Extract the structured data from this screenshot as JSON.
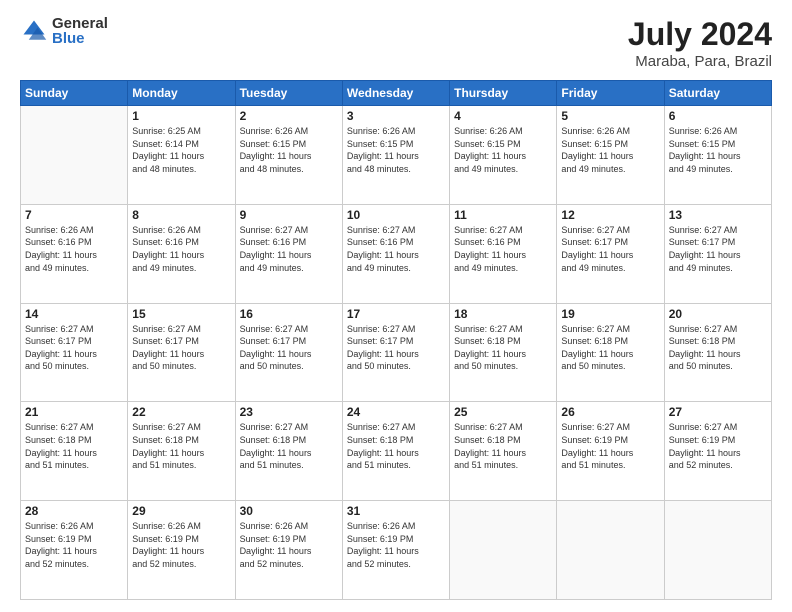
{
  "header": {
    "logo_general": "General",
    "logo_blue": "Blue",
    "month_year": "July 2024",
    "location": "Maraba, Para, Brazil"
  },
  "days_of_week": [
    "Sunday",
    "Monday",
    "Tuesday",
    "Wednesday",
    "Thursday",
    "Friday",
    "Saturday"
  ],
  "weeks": [
    [
      {
        "day": "",
        "info": ""
      },
      {
        "day": "1",
        "info": "Sunrise: 6:25 AM\nSunset: 6:14 PM\nDaylight: 11 hours\nand 48 minutes."
      },
      {
        "day": "2",
        "info": "Sunrise: 6:26 AM\nSunset: 6:15 PM\nDaylight: 11 hours\nand 48 minutes."
      },
      {
        "day": "3",
        "info": "Sunrise: 6:26 AM\nSunset: 6:15 PM\nDaylight: 11 hours\nand 48 minutes."
      },
      {
        "day": "4",
        "info": "Sunrise: 6:26 AM\nSunset: 6:15 PM\nDaylight: 11 hours\nand 49 minutes."
      },
      {
        "day": "5",
        "info": "Sunrise: 6:26 AM\nSunset: 6:15 PM\nDaylight: 11 hours\nand 49 minutes."
      },
      {
        "day": "6",
        "info": "Sunrise: 6:26 AM\nSunset: 6:15 PM\nDaylight: 11 hours\nand 49 minutes."
      }
    ],
    [
      {
        "day": "7",
        "info": "Sunrise: 6:26 AM\nSunset: 6:16 PM\nDaylight: 11 hours\nand 49 minutes."
      },
      {
        "day": "8",
        "info": "Sunrise: 6:26 AM\nSunset: 6:16 PM\nDaylight: 11 hours\nand 49 minutes."
      },
      {
        "day": "9",
        "info": "Sunrise: 6:27 AM\nSunset: 6:16 PM\nDaylight: 11 hours\nand 49 minutes."
      },
      {
        "day": "10",
        "info": "Sunrise: 6:27 AM\nSunset: 6:16 PM\nDaylight: 11 hours\nand 49 minutes."
      },
      {
        "day": "11",
        "info": "Sunrise: 6:27 AM\nSunset: 6:16 PM\nDaylight: 11 hours\nand 49 minutes."
      },
      {
        "day": "12",
        "info": "Sunrise: 6:27 AM\nSunset: 6:17 PM\nDaylight: 11 hours\nand 49 minutes."
      },
      {
        "day": "13",
        "info": "Sunrise: 6:27 AM\nSunset: 6:17 PM\nDaylight: 11 hours\nand 49 minutes."
      }
    ],
    [
      {
        "day": "14",
        "info": "Sunrise: 6:27 AM\nSunset: 6:17 PM\nDaylight: 11 hours\nand 50 minutes."
      },
      {
        "day": "15",
        "info": "Sunrise: 6:27 AM\nSunset: 6:17 PM\nDaylight: 11 hours\nand 50 minutes."
      },
      {
        "day": "16",
        "info": "Sunrise: 6:27 AM\nSunset: 6:17 PM\nDaylight: 11 hours\nand 50 minutes."
      },
      {
        "day": "17",
        "info": "Sunrise: 6:27 AM\nSunset: 6:17 PM\nDaylight: 11 hours\nand 50 minutes."
      },
      {
        "day": "18",
        "info": "Sunrise: 6:27 AM\nSunset: 6:18 PM\nDaylight: 11 hours\nand 50 minutes."
      },
      {
        "day": "19",
        "info": "Sunrise: 6:27 AM\nSunset: 6:18 PM\nDaylight: 11 hours\nand 50 minutes."
      },
      {
        "day": "20",
        "info": "Sunrise: 6:27 AM\nSunset: 6:18 PM\nDaylight: 11 hours\nand 50 minutes."
      }
    ],
    [
      {
        "day": "21",
        "info": "Sunrise: 6:27 AM\nSunset: 6:18 PM\nDaylight: 11 hours\nand 51 minutes."
      },
      {
        "day": "22",
        "info": "Sunrise: 6:27 AM\nSunset: 6:18 PM\nDaylight: 11 hours\nand 51 minutes."
      },
      {
        "day": "23",
        "info": "Sunrise: 6:27 AM\nSunset: 6:18 PM\nDaylight: 11 hours\nand 51 minutes."
      },
      {
        "day": "24",
        "info": "Sunrise: 6:27 AM\nSunset: 6:18 PM\nDaylight: 11 hours\nand 51 minutes."
      },
      {
        "day": "25",
        "info": "Sunrise: 6:27 AM\nSunset: 6:18 PM\nDaylight: 11 hours\nand 51 minutes."
      },
      {
        "day": "26",
        "info": "Sunrise: 6:27 AM\nSunset: 6:19 PM\nDaylight: 11 hours\nand 51 minutes."
      },
      {
        "day": "27",
        "info": "Sunrise: 6:27 AM\nSunset: 6:19 PM\nDaylight: 11 hours\nand 52 minutes."
      }
    ],
    [
      {
        "day": "28",
        "info": "Sunrise: 6:26 AM\nSunset: 6:19 PM\nDaylight: 11 hours\nand 52 minutes."
      },
      {
        "day": "29",
        "info": "Sunrise: 6:26 AM\nSunset: 6:19 PM\nDaylight: 11 hours\nand 52 minutes."
      },
      {
        "day": "30",
        "info": "Sunrise: 6:26 AM\nSunset: 6:19 PM\nDaylight: 11 hours\nand 52 minutes."
      },
      {
        "day": "31",
        "info": "Sunrise: 6:26 AM\nSunset: 6:19 PM\nDaylight: 11 hours\nand 52 minutes."
      },
      {
        "day": "",
        "info": ""
      },
      {
        "day": "",
        "info": ""
      },
      {
        "day": "",
        "info": ""
      }
    ]
  ]
}
